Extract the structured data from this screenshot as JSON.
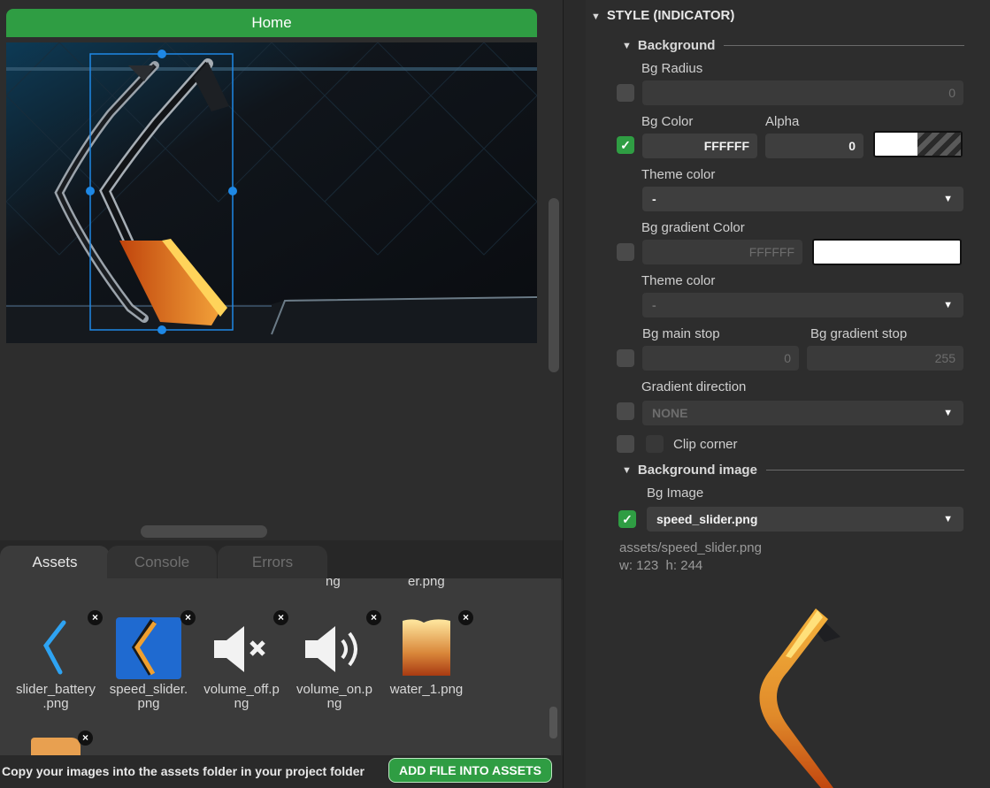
{
  "screen": {
    "tab_label": "Home"
  },
  "bottom_tabs": [
    {
      "label": "Assets"
    },
    {
      "label": "Console"
    },
    {
      "label": "Errors"
    }
  ],
  "assets": {
    "cut_labels": [
      "ng",
      "er.png"
    ],
    "items": [
      {
        "name_line1": "slider_battery",
        "name_line2": ".png",
        "icon": "chevron-blue"
      },
      {
        "name_line1": "speed_slider.",
        "name_line2": "png",
        "icon": "speed-slider",
        "selected": true
      },
      {
        "name_line1": "volume_off.p",
        "name_line2": "ng",
        "icon": "volume-off"
      },
      {
        "name_line1": "volume_on.p",
        "name_line2": "ng",
        "icon": "volume-on"
      },
      {
        "name_line1": "water_1.png",
        "name_line2": "",
        "icon": "water"
      }
    ],
    "close_glyph": "×",
    "hint": "Copy your images into the assets folder in your project folder",
    "add_button": "ADD FILE INTO ASSETS"
  },
  "style_panel": {
    "title": "STYLE (INDICATOR)",
    "background": {
      "heading": "Background",
      "bg_radius": {
        "label": "Bg Radius",
        "value": "0",
        "checked": false
      },
      "bg_color": {
        "label": "Bg Color",
        "value": "FFFFFF",
        "checked": true
      },
      "alpha": {
        "label": "Alpha",
        "value": "0"
      },
      "theme_color_1": {
        "label": "Theme color",
        "value": "-"
      },
      "bg_gradient": {
        "label": "Bg gradient Color",
        "value": "FFFFFF",
        "checked": false
      },
      "theme_color_2": {
        "label": "Theme color",
        "value": "-"
      },
      "bg_main_stop": {
        "label": "Bg main stop",
        "value": "0"
      },
      "bg_gradient_stop": {
        "label": "Bg gradient stop",
        "value": "255"
      },
      "gradient_direction": {
        "label": "Gradient direction",
        "value": "NONE"
      },
      "clip_corner": {
        "label": "Clip corner"
      }
    },
    "background_image": {
      "heading": "Background image",
      "bg_image_label": "Bg Image",
      "bg_image_value": "speed_slider.png",
      "checked": true,
      "path": "assets/speed_slider.png",
      "width_text": "w: 123",
      "height_text": "h: 244"
    }
  },
  "check_glyph": "✓",
  "arrow_glyph": "▼",
  "colors": {
    "accent_green": "#2f9d43",
    "selection_blue": "#1e88e5"
  }
}
